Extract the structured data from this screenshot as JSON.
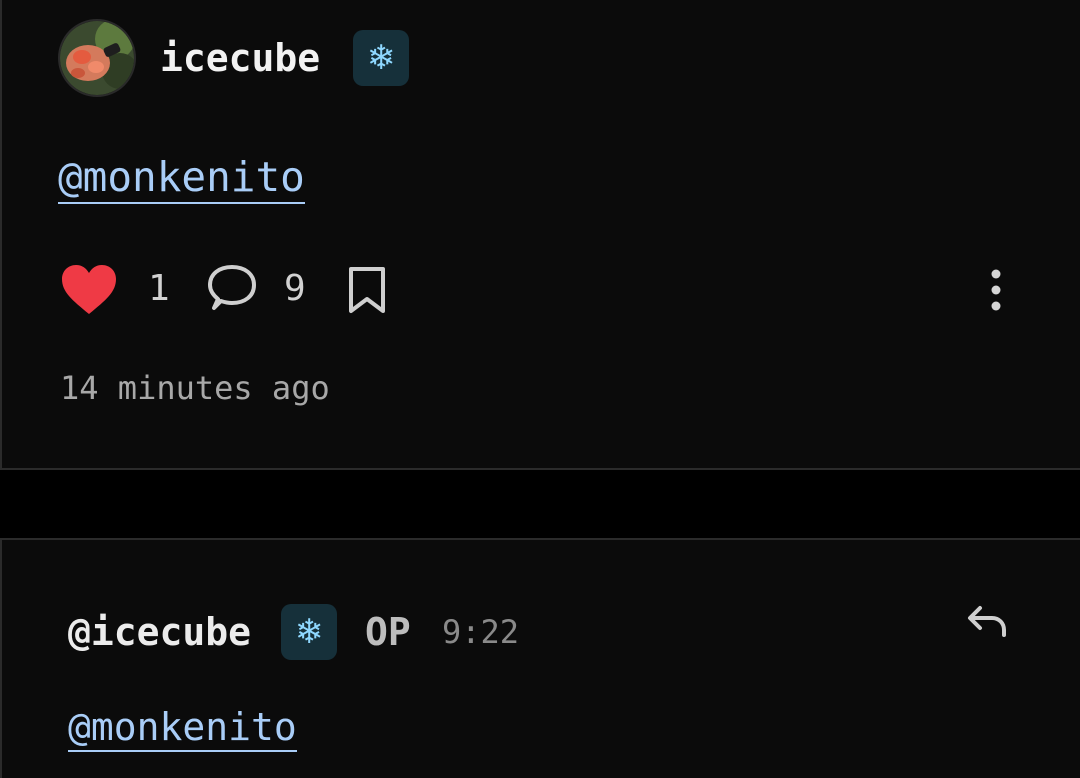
{
  "post": {
    "username": "icecube",
    "badge_icon": "snowflake-icon",
    "body_mention": "@monkenito",
    "likes": "1",
    "comments": "9",
    "time_ago": "14 minutes ago",
    "liked": true
  },
  "reply": {
    "author": "@icecube",
    "badge_icon": "snowflake-icon",
    "op_label": "OP",
    "time": "9:22",
    "body_mention": "@monkenito"
  },
  "colors": {
    "background": "#000000",
    "card": "#0b0b0b",
    "heart": "#ef3a45",
    "link": "#a9cdf7",
    "badge_bg": "#16303a",
    "badge_fg": "#8fd8ff"
  }
}
